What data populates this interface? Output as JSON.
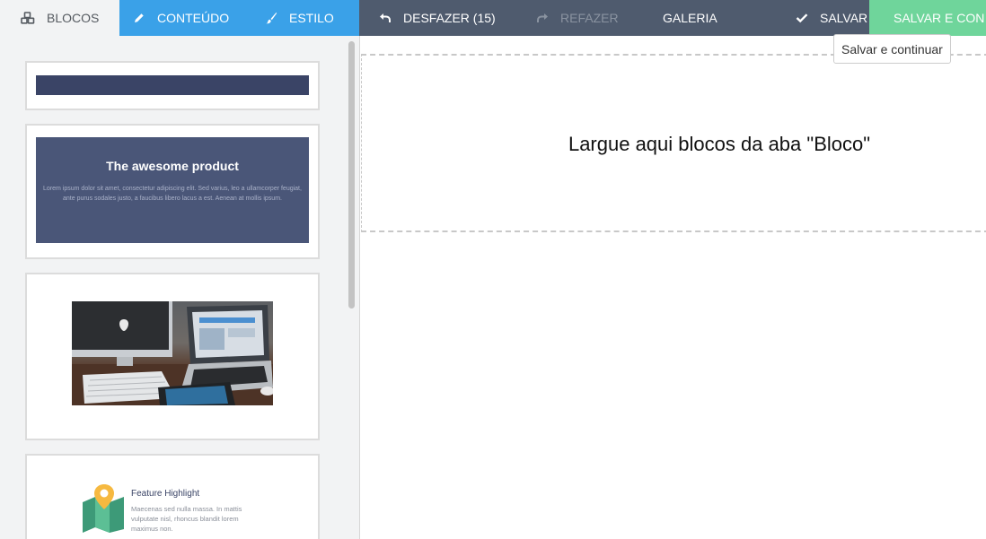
{
  "toolbar": {
    "tabs": {
      "blocks": {
        "label": "BLOCOS",
        "icon": "cubes-icon"
      },
      "content": {
        "label": "CONTEÚDO",
        "icon": "pencil-icon"
      },
      "style": {
        "label": "ESTILO",
        "icon": "paintbrush-icon"
      }
    },
    "actions": {
      "undo": {
        "label": "DESFAZER (15)",
        "icon": "undo-icon"
      },
      "redo": {
        "label": "REFAZER",
        "icon": "redo-icon",
        "disabled": true
      },
      "gallery": {
        "label": "GALERIA"
      },
      "save": {
        "label": "SALVAR",
        "icon": "check-icon"
      },
      "save_continue": {
        "label": "SALVAR E CON"
      }
    },
    "active_tab": "blocks",
    "colors": {
      "bar": "#4f5b6e",
      "active_tab": "#f2f3f4",
      "accent": "#3aa1e8",
      "save_continue": "#6fd59b"
    }
  },
  "tooltip": {
    "text": "Salvar e continuar"
  },
  "sidebar": {
    "blocks": [
      {
        "type": "separator-bar"
      },
      {
        "type": "hero",
        "title": "The awesome product",
        "text": "Lorem ipsum dolor sit amet, consectetur adipiscing elit. Sed varius, leo a ullamcorper feugiat, ante purus sodales justo, a faucibus libero lacus a est. Aenean at mollis ipsum."
      },
      {
        "type": "image",
        "image": "workspace-photo"
      },
      {
        "type": "feature",
        "icon": "map-pin-icon",
        "title": "Feature Highlight",
        "text": "Maecenas sed nulla massa. In mattis vulputate nisl, rhoncus blandit lorem maximus non."
      }
    ]
  },
  "canvas": {
    "drop_message": "Largue aqui blocos da aba \"Bloco\""
  }
}
